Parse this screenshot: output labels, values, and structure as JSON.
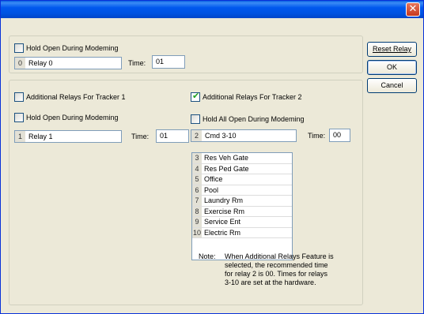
{
  "buttons": {
    "reset": "Reset Relay",
    "ok": "OK",
    "cancel": "Cancel"
  },
  "main": {
    "hold_open_label": "Hold Open During Modeming",
    "relay": {
      "num": "0",
      "name": "Relay 0"
    },
    "time_label": "Time:",
    "time_value": "01"
  },
  "tracker1": {
    "additional_label": "Additional Relays For Tracker 1",
    "hold_open_label": "Hold Open During Modeming",
    "relay": {
      "num": "1",
      "name": "Relay 1"
    },
    "time_label": "Time:",
    "time_value": "01"
  },
  "tracker2": {
    "additional_label": "Additional Relays For Tracker 2",
    "hold_all_label": "Hold All Open During Modeming",
    "relay": {
      "num": "2",
      "name": "Cmd 3-10"
    },
    "time_label": "Time:",
    "time_value": "00",
    "relays": [
      {
        "num": "3",
        "name": "Res Veh Gate"
      },
      {
        "num": "4",
        "name": "Res Ped Gate"
      },
      {
        "num": "5",
        "name": "Office"
      },
      {
        "num": "6",
        "name": "Pool"
      },
      {
        "num": "7",
        "name": "Laundry Rm"
      },
      {
        "num": "8",
        "name": "Exercise Rm"
      },
      {
        "num": "9",
        "name": "Service Ent"
      },
      {
        "num": "10",
        "name": "Electric Rm"
      }
    ],
    "note_label": "Note:",
    "note_text": "When Additional Relays Feature is selected, the recommended time for relay 2 is 00. Times for relays 3-10 are set at the hardware."
  }
}
